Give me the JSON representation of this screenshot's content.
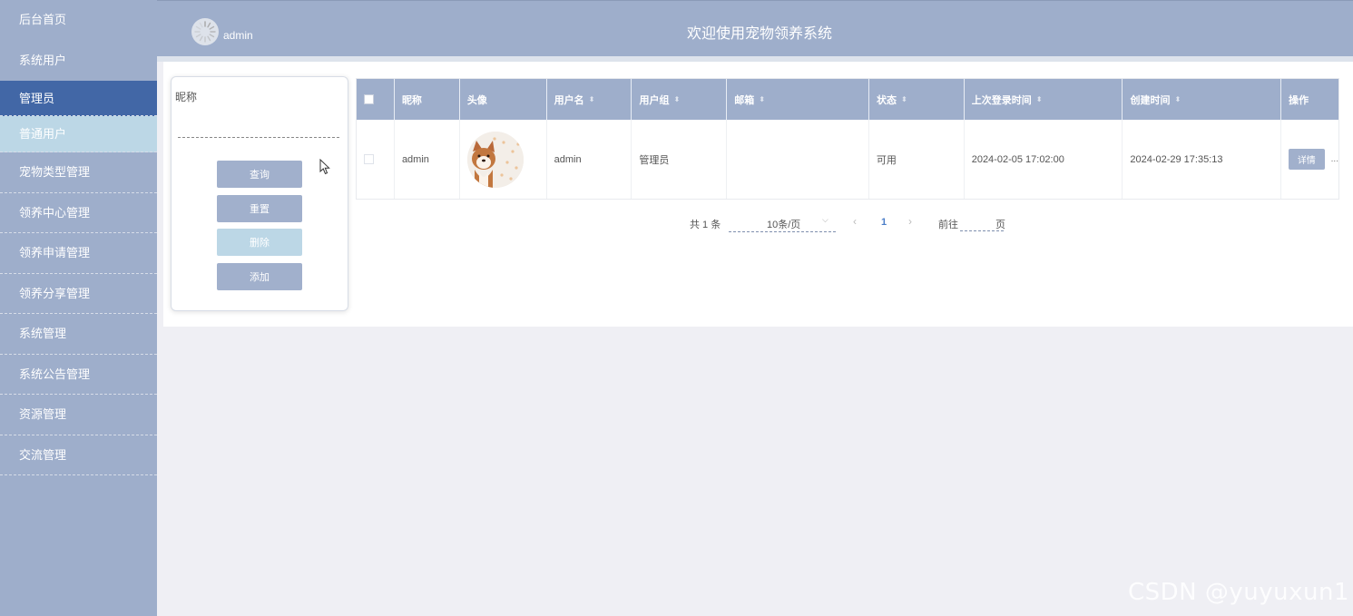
{
  "sidebar": {
    "items": [
      {
        "label": "后台首页"
      },
      {
        "label": "系统用户"
      },
      {
        "label": "管理员"
      },
      {
        "label": "普通用户"
      },
      {
        "label": "宠物类型管理"
      },
      {
        "label": "领养中心管理"
      },
      {
        "label": "领养申请管理"
      },
      {
        "label": "领养分享管理"
      },
      {
        "label": "系统管理"
      },
      {
        "label": "系统公告管理"
      },
      {
        "label": "资源管理"
      },
      {
        "label": "交流管理"
      }
    ]
  },
  "header": {
    "username": "admin",
    "title": "欢迎使用宠物领养系统"
  },
  "search": {
    "label": "昵称",
    "value": "",
    "buttons": {
      "query": "查询",
      "reset": "重置",
      "delete": "删除",
      "add": "添加"
    }
  },
  "table": {
    "columns": [
      "昵称",
      "头像",
      "用户名",
      "用户组",
      "邮箱",
      "状态",
      "上次登录时间",
      "创建时间",
      "操作"
    ],
    "rows": [
      {
        "nickname": "admin",
        "username": "admin",
        "group": "管理员",
        "email": "",
        "status": "可用",
        "last_login": "2024-02-05 17:02:00",
        "created": "2024-02-29 17:35:13",
        "action": "详情",
        "more": "..."
      }
    ]
  },
  "pagination": {
    "total": "共 1 条",
    "page_size": "10条/页",
    "current_page": "1",
    "goto": "前往",
    "goto_value": "",
    "unit": "页"
  },
  "icons": {
    "sort": "sort-caret-icon",
    "dropdown": "chevron-down-icon",
    "prev": "chevron-left-icon",
    "next": "chevron-right-icon"
  },
  "colors": {
    "sidebar_bg": "#9eaecb",
    "active_bg": "#4267a6",
    "sub_bg": "#bcd7e6",
    "button_bg": "#a1b0cc"
  },
  "watermark": "CSDN @yuyuxun1"
}
